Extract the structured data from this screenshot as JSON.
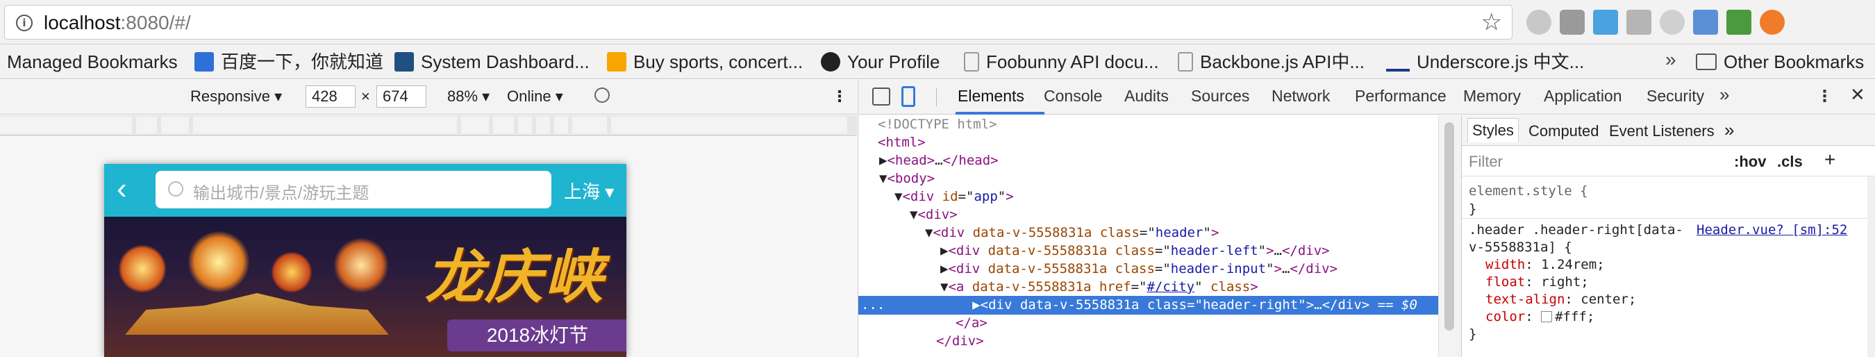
{
  "browser": {
    "url_host": "localhost",
    "url_rest": ":8080/#/",
    "bookmarks": [
      {
        "label": "Managed Bookmarks",
        "icon": "none"
      },
      {
        "label": "百度一下，你就知道",
        "icon": "paw-icon",
        "color": "#2f6fd8"
      },
      {
        "label": "System Dashboard...",
        "icon": "jira-icon",
        "color": "#205081"
      },
      {
        "label": "Buy sports, concert...",
        "icon": "ticket-icon",
        "color": "#f7a600"
      },
      {
        "label": "Your Profile",
        "icon": "github-icon",
        "color": "#222222"
      },
      {
        "label": "Foobunny API docu...",
        "icon": "page-icon",
        "color": "#999999"
      },
      {
        "label": "Backbone.js API中...",
        "icon": "page-icon",
        "color": "#999999"
      },
      {
        "label": "Underscore.js 中文...",
        "icon": "underscore-icon",
        "color": "#1a3a8a"
      }
    ],
    "other_bookmarks": "Other Bookmarks"
  },
  "device_toolbar": {
    "mode": "Responsive",
    "width": "428",
    "times": "×",
    "height": "674",
    "zoom": "88%",
    "network": "Online"
  },
  "mobile_page": {
    "search_placeholder": "输出城市/景点/游玩主题",
    "city": "上海",
    "banner_title": "龙庆峡",
    "banner_subtitle": "2018冰灯节"
  },
  "devtools": {
    "tabs": [
      "Elements",
      "Console",
      "Audits",
      "Sources",
      "Network",
      "Performance",
      "Memory",
      "Application",
      "Security"
    ],
    "more": "»",
    "dom": {
      "l1": "<!DOCTYPE html>",
      "l2_tag": "<html>",
      "l3_open": "<head>",
      "l3_mid": "…",
      "l3_close": "</head>",
      "l4_tag": "<body>",
      "l5_tag": "<div",
      "l5_attr": "id",
      "l5_val": "app",
      "l6_tag": "<div>",
      "l7_tag": "<div",
      "l7_attr": "data-v-5558831a class",
      "l7_val": "header",
      "l8_val": "header-left",
      "l9_val": "header-input",
      "l10_tag": "<a",
      "l10_attr": "data-v-5558831a href",
      "l10_href": "#/city",
      "l10_class": "class",
      "l11_val": "header-right",
      "l11_suffix": "== $0",
      "l12_tag": "</a>",
      "l13_tag": "</div>",
      "ellipsis": "..."
    },
    "styles": {
      "tabs": [
        "Styles",
        "Computed",
        "Event Listeners"
      ],
      "more": "»",
      "filter": "Filter",
      "hov": ":hov",
      "cls": ".cls",
      "add": "+",
      "element_style": "element.style {",
      "close_brace": "}",
      "rule_selector_1": ".header .header-right[data-",
      "rule_selector_2": "v-5558831a] {",
      "rule_source": "Header.vue? [sm]:52",
      "props": [
        {
          "name": "width",
          "value": "1.24rem;"
        },
        {
          "name": "float",
          "value": "right;"
        },
        {
          "name": "text-align",
          "value": "center;"
        },
        {
          "name": "color",
          "value": "#fff;"
        }
      ]
    }
  }
}
